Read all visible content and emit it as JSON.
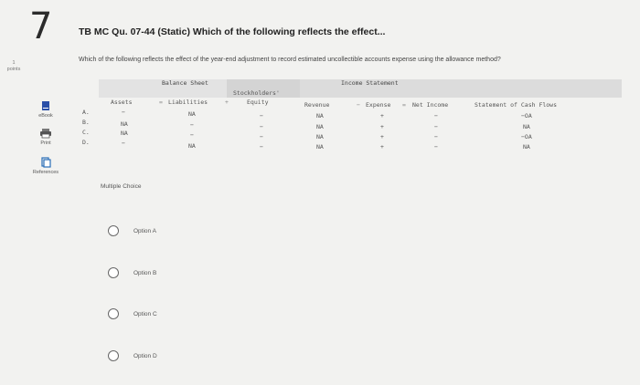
{
  "question": {
    "number": "7",
    "points": "1\npoints",
    "title": "TB MC Qu. 07-44 (Static) Which of the following reflects the effect...",
    "text": "Which of the following reflects the effect of the year-end adjustment to record estimated uncollectible accounts expense using the allowance method?"
  },
  "tools": [
    {
      "label": "eBook",
      "icon": "book-icon"
    },
    {
      "label": "Print",
      "icon": "print-icon"
    },
    {
      "label": "References",
      "icon": "references-icon"
    }
  ],
  "table": {
    "group_balance_sheet": "Balance Sheet",
    "group_income_statement": "Income Statement",
    "col_assets": "Assets",
    "col_liabilities": "Liabilities",
    "col_equity_1": "Stockholders'",
    "col_equity_2": "Equity",
    "col_revenue": "Revenue",
    "col_expense": "Expense",
    "col_net_income": "Net Income",
    "col_cash_flows": "Statement of Cash Flows",
    "sep_equals": "=",
    "sep_plus": "+",
    "sep_minus": "−",
    "rows": [
      {
        "letter": "A.",
        "assets": "−",
        "liabilities": "NA",
        "equity": "−",
        "revenue": "NA",
        "expense": "+",
        "net_income": "−",
        "cash": "−OA"
      },
      {
        "letter": "B.",
        "assets": "NA",
        "liabilities": "−",
        "equity": "−",
        "revenue": "NA",
        "expense": "+",
        "net_income": "−",
        "cash": "NA"
      },
      {
        "letter": "C.",
        "assets": "NA",
        "liabilities": "−",
        "equity": "−",
        "revenue": "NA",
        "expense": "+",
        "net_income": "−",
        "cash": "−OA"
      },
      {
        "letter": "D.",
        "assets": "−",
        "liabilities": "NA",
        "equity": "−",
        "revenue": "NA",
        "expense": "+",
        "net_income": "−",
        "cash": "NA"
      }
    ]
  },
  "choices": {
    "label": "Multiple Choice",
    "options": [
      "Option A",
      "Option B",
      "Option C",
      "Option D"
    ]
  },
  "colors": {
    "header_band": "#d4d4d4",
    "page_bg": "#f2f2f0",
    "ebook_icon": "#2a4fa8",
    "references_icon": "#2a6fb8"
  }
}
